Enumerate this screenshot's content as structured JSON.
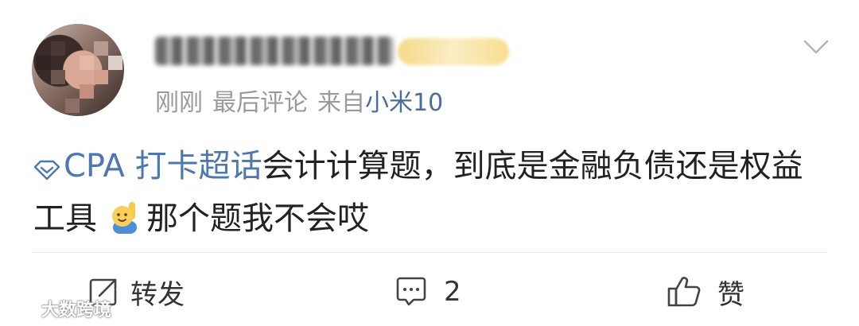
{
  "post": {
    "meta": {
      "time": "刚刚",
      "comment_status": "最后评论",
      "source_prefix": "来自",
      "device": "小米10"
    },
    "content": {
      "topic": "CPA 打卡超话",
      "text_before_emoji": "会计计算题，到底是金融负债还是权益工具",
      "emoji": "raising-hand-emoji",
      "text_after_emoji": "那个题我不会哎"
    }
  },
  "actions": {
    "repost_label": "转发",
    "comment_count": "2",
    "like_label": "赞"
  },
  "watermark": {
    "text": "大数跨境"
  },
  "colors": {
    "topic": "#4d77b0",
    "device": "#4a6d9c",
    "meta": "#9a9a9a",
    "text": "#222222"
  },
  "icons": [
    "chevron-down-icon",
    "super-topic-diamond-icon",
    "repost-icon",
    "comment-icon",
    "like-icon"
  ]
}
